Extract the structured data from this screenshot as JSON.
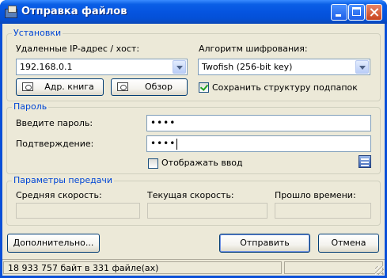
{
  "window": {
    "title": "Отправка файлов"
  },
  "settings": {
    "group_title": "Установки",
    "host_label": "Удаленные IP-адрес / хост:",
    "host_value": "192.168.0.1",
    "cipher_label": "Алгоритм шифрования:",
    "cipher_value": "Twofish (256-bit key)",
    "address_book_label": "Адр. книга",
    "browse_label": "Обзор",
    "keep_structure_label": "Сохранить структуру подпапок",
    "keep_structure_checked": true
  },
  "password": {
    "group_title": "Пароль",
    "enter_label": "Введите пароль:",
    "enter_value": "••••",
    "confirm_label": "Подтверждение:",
    "confirm_value": "••••",
    "show_input_label": "Отображать ввод",
    "show_input_checked": false
  },
  "transfer": {
    "group_title": "Параметры передачи",
    "avg_speed_label": "Средняя скорость:",
    "cur_speed_label": "Текущая скорость:",
    "elapsed_label": "Прошло времени:",
    "avg_speed_value": "",
    "cur_speed_value": "",
    "elapsed_value": ""
  },
  "buttons": {
    "advanced": "Дополнительно...",
    "send": "Отправить",
    "cancel": "Отмена"
  },
  "status": {
    "text": "18 933 757 байт в 331 файле(ах)"
  }
}
